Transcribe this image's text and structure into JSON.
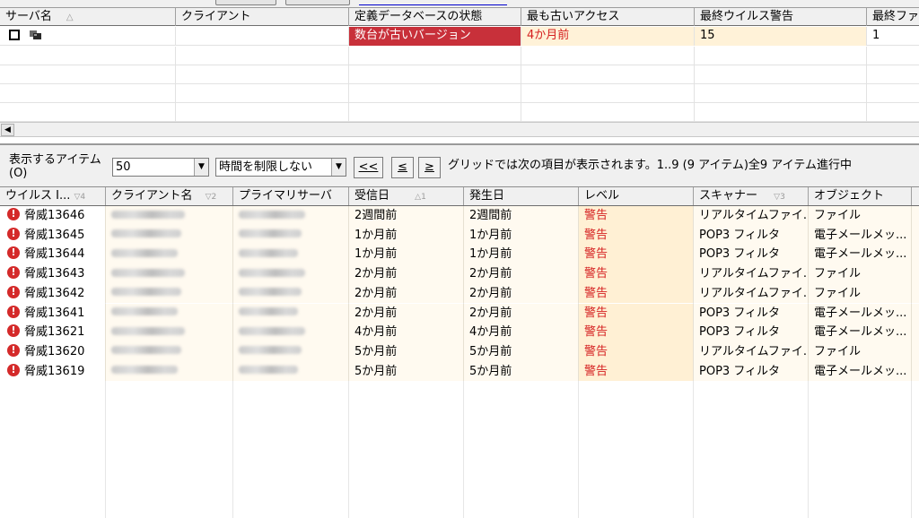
{
  "upper_grid": {
    "columns": [
      "サーバ名",
      "クライアント",
      "定義データベースの状態",
      "最も古いアクセス",
      "最終ウイルス警告",
      "最終ファ"
    ],
    "sort_indicator": "△",
    "rows": [
      {
        "client": "",
        "def_state": "数台が古いバージョン",
        "oldest_access": "4か月前",
        "last_virus_alert": "15",
        "last_file": "1"
      }
    ]
  },
  "pager": {
    "items_label": "表示するアイテム (O)",
    "items_value": "50",
    "time_value": "時間を制限しない",
    "first_label": "<<",
    "prev_label": "≤",
    "next_label": "≥",
    "status": "グリッドでは次の項目が表示されます。1..9 (9 アイテム)全9 アイテム進行中"
  },
  "lower_grid": {
    "columns": [
      "ウイルス I...",
      "クライアント名",
      "プライマリサーバ",
      "受信日",
      "発生日",
      "レベル",
      "スキャナー",
      "オブジェクト"
    ],
    "sort_marks": [
      "▽4",
      "▽2",
      "",
      "△1",
      "",
      "",
      "▽3",
      ""
    ],
    "rows": [
      {
        "virus": "脅威13646",
        "received": "2週間前",
        "occurred": "2週間前",
        "level": "警告",
        "scanner": "リアルタイムファイ...",
        "object": "ファイル"
      },
      {
        "virus": "脅威13645",
        "received": "1か月前",
        "occurred": "1か月前",
        "level": "警告",
        "scanner": "POP3 フィルタ",
        "object": "電子メールメッ..."
      },
      {
        "virus": "脅威13644",
        "received": "1か月前",
        "occurred": "1か月前",
        "level": "警告",
        "scanner": "POP3 フィルタ",
        "object": "電子メールメッ..."
      },
      {
        "virus": "脅威13643",
        "received": "2か月前",
        "occurred": "2か月前",
        "level": "警告",
        "scanner": "リアルタイムファイ...",
        "object": "ファイル"
      },
      {
        "virus": "脅威13642",
        "received": "2か月前",
        "occurred": "2か月前",
        "level": "警告",
        "scanner": "リアルタイムファイ...",
        "object": "ファイル"
      },
      {
        "virus": "脅威13641",
        "received": "2か月前",
        "occurred": "2か月前",
        "level": "警告",
        "scanner": "POP3 フィルタ",
        "object": "電子メールメッ..."
      },
      {
        "virus": "脅威13621",
        "received": "4か月前",
        "occurred": "4か月前",
        "level": "警告",
        "scanner": "POP3 フィルタ",
        "object": "電子メールメッ..."
      },
      {
        "virus": "脅威13620",
        "received": "5か月前",
        "occurred": "5か月前",
        "level": "警告",
        "scanner": "リアルタイムファイ...",
        "object": "ファイル"
      },
      {
        "virus": "脅威13619",
        "received": "5か月前",
        "occurred": "5か月前",
        "level": "警告",
        "scanner": "POP3 フィルタ",
        "object": "電子メールメッ..."
      }
    ]
  },
  "icons": {
    "error": "error-icon",
    "server": "server-group-icon"
  },
  "colors": {
    "outdated_cell": "#c8303a",
    "warning_text": "#d52020",
    "cream_cell": "#fff2d8"
  }
}
